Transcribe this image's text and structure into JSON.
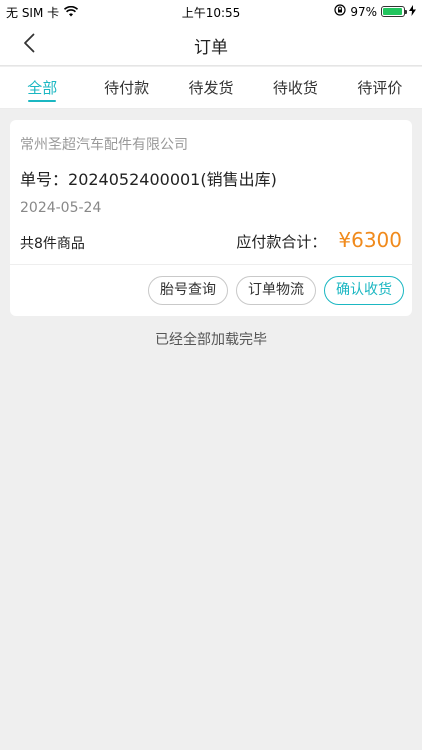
{
  "status_bar": {
    "carrier": "无 SIM 卡",
    "wifi_icon": "wifi-icon",
    "time": "上午10:55",
    "orientation_lock_icon": "orientation-lock-icon",
    "battery_percent": "97%",
    "battery_level": 0.97,
    "battery_color": "#22c55e",
    "charging_icon": "charging-bolt-icon"
  },
  "nav": {
    "back_icon": "chevron-left-icon",
    "title": "订单"
  },
  "tabs": [
    {
      "label": "全部",
      "active": true
    },
    {
      "label": "待付款",
      "active": false
    },
    {
      "label": "待发货",
      "active": false
    },
    {
      "label": "待收货",
      "active": false
    },
    {
      "label": "待评价",
      "active": false
    }
  ],
  "accent_color": "#1bb7c2",
  "price_color": "#f08a1c",
  "order": {
    "company": "常州圣超汽车配件有限公司",
    "order_no_label": "单号：",
    "order_no": "2024052400001(销售出库)",
    "date": "2024-05-24",
    "items_count": "共8件商品",
    "total_label": "应付款合计：",
    "total_amount": "¥6300",
    "actions": {
      "tire_lookup": "胎号查询",
      "logistics": "订单物流",
      "confirm_receipt": "确认收货"
    }
  },
  "load_complete_text": "已经全部加载完毕"
}
